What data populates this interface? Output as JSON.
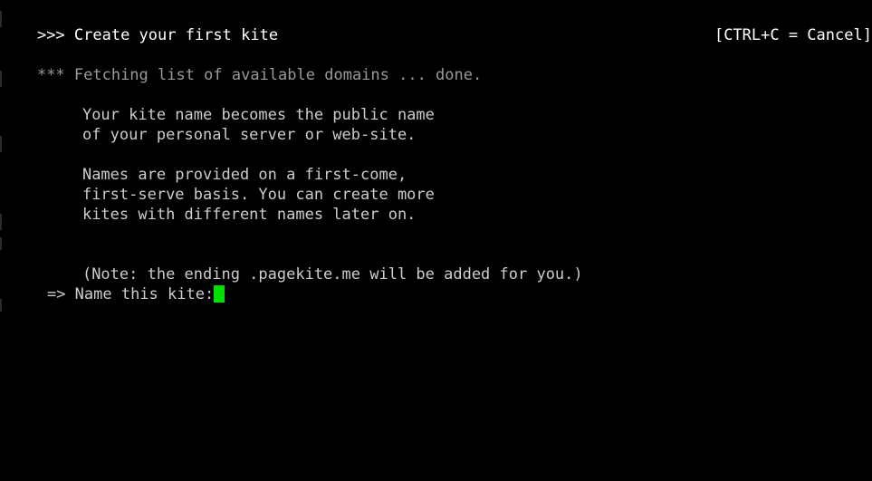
{
  "terminal": {
    "background_color": "#000000",
    "default_text_color": "#cccccc",
    "bright_text_color": "#ffffff",
    "dim_text_color": "#9a9a9a",
    "cursor_color": "#00e000",
    "columns": 82,
    "rows": 24
  },
  "header": {
    "prefix": ">>>",
    "title": "Create your first kite",
    "full_line": ">>> Create your first kite",
    "hint": "[CTRL+C = Cancel]",
    "hint_key": "CTRL+C",
    "hint_action": "Cancel"
  },
  "status": {
    "prefix": "***",
    "message": "Fetching list of available domains ... done.",
    "full_line": "*** Fetching list of available domains ... done.",
    "state": "done."
  },
  "body": {
    "paragraph_1": [
      "Your kite name becomes the public name",
      "of your personal server or web-site."
    ],
    "paragraph_2": [
      "Names are provided on a first-come,",
      "first-serve basis. You can create more",
      "kites with different names later on."
    ],
    "note": "(Note: the ending .pagekite.me will be added for you.)",
    "note_domain_suffix": ".pagekite.me"
  },
  "prompt": {
    "marker": "=>",
    "label": "Name this kite:",
    "full_line": "=> Name this kite:",
    "input_value": "",
    "cursor_visible": true
  }
}
